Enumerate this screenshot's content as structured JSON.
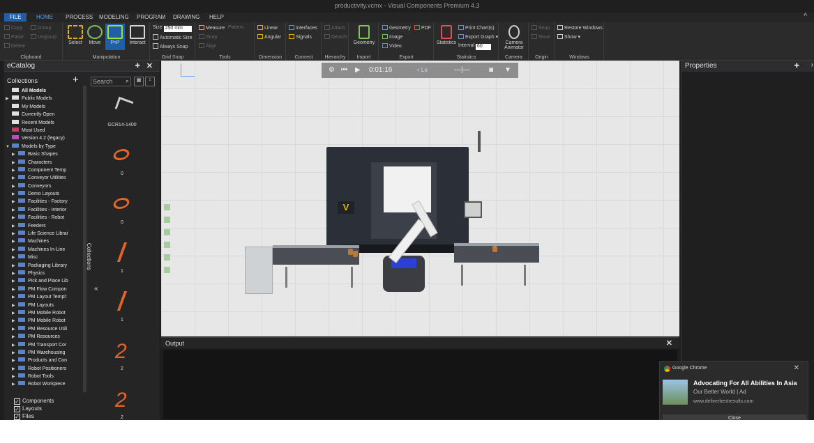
{
  "window": {
    "title": "productivity.vcmx - Visual Components Premium 4.3"
  },
  "menu": {
    "file": "FILE",
    "home": "HOME",
    "process": "PROCESS",
    "modeling": "MODELING",
    "program": "PROGRAM",
    "drawing": "DRAWING",
    "help": "HELP"
  },
  "ribbon": {
    "clipboard": {
      "copy": "Copy",
      "paste": "Paste",
      "delete": "Delete",
      "group": "Group",
      "ungroup": "Ungroup",
      "label": "Clipboard"
    },
    "manipulation": {
      "select": "Select",
      "move": "Move",
      "pnp": "PnP",
      "interact": "Interact",
      "label": "Manipulation"
    },
    "gridsnap": {
      "size_label": "Size",
      "size_value": "250",
      "unit": "mm",
      "automatic_size": "Automatic Size",
      "always_snap": "Always Snap",
      "label": "Grid Snap"
    },
    "tools": {
      "measure": "Measure",
      "pattern": "Pattern",
      "snap": "Snap",
      "align": "Align",
      "label": "Tools"
    },
    "dimension": {
      "linear": "Linear",
      "angular": "Angular",
      "label": "Dimension"
    },
    "connect": {
      "interfaces": "Interfaces",
      "signals": "Signals",
      "label": "Connect"
    },
    "hierarchy": {
      "attach": "Attach",
      "detach": "Detach",
      "label": "Hierarchy"
    },
    "import": {
      "geometry": "Geometry",
      "label": "Import"
    },
    "export": {
      "geometry": "Geometry",
      "pdf": "PDF",
      "image": "Image",
      "video": "Video",
      "label": "Export"
    },
    "statistics": {
      "statistics": "Statistics",
      "print_charts": "Print Chart(s)",
      "export_graph": "Export Graph",
      "interval": "Interval",
      "interval_value": "60",
      "label": "Statistics"
    },
    "camera": {
      "camera_animator": "Camera Animator",
      "label": "Camera"
    },
    "origin": {
      "snap": "Snap",
      "move": "Move",
      "label": "Origin"
    },
    "windows": {
      "restore": "Restore Windows",
      "show": "Show",
      "label": "Windows"
    }
  },
  "ecatalog": {
    "title": "eCatalog",
    "collections_title": "Collections",
    "search_placeholder": "Search",
    "collections_tab": "Collections",
    "tree": [
      {
        "label": "All Models",
        "icon": "w",
        "arrow": "",
        "bold": true
      },
      {
        "label": "Public Models",
        "icon": "w",
        "arrow": "▶"
      },
      {
        "label": "My Models",
        "icon": "w",
        "arrow": ""
      },
      {
        "label": "Currently Open",
        "icon": "w",
        "arrow": ""
      },
      {
        "label": "Recent Models",
        "icon": "w",
        "arrow": ""
      },
      {
        "label": "Most Used",
        "icon": "r",
        "arrow": ""
      },
      {
        "label": "Version 4.2 (legacy)",
        "icon": "p",
        "arrow": ""
      },
      {
        "label": "Models by Type",
        "icon": "b",
        "arrow": "▼"
      },
      {
        "label": "Basic Shapes",
        "icon": "b",
        "arrow": "▶",
        "indent": true
      },
      {
        "label": "Characters",
        "icon": "b",
        "arrow": "▶",
        "indent": true
      },
      {
        "label": "Component Temp",
        "icon": "b",
        "arrow": "▶",
        "indent": true
      },
      {
        "label": "Conveyor Utilities",
        "icon": "b",
        "arrow": "▶",
        "indent": true
      },
      {
        "label": "Conveyors",
        "icon": "b",
        "arrow": "▶",
        "indent": true
      },
      {
        "label": "Demo Layouts",
        "icon": "b",
        "arrow": "▶",
        "indent": true
      },
      {
        "label": "Facilities - Factory",
        "icon": "b",
        "arrow": "▶",
        "indent": true
      },
      {
        "label": "Facilities - Interior",
        "icon": "b",
        "arrow": "▶",
        "indent": true
      },
      {
        "label": "Facilities - Robot",
        "icon": "b",
        "arrow": "▶",
        "indent": true
      },
      {
        "label": "Feeders",
        "icon": "b",
        "arrow": "▶",
        "indent": true
      },
      {
        "label": "Life Science Librai",
        "icon": "b",
        "arrow": "▶",
        "indent": true
      },
      {
        "label": "Machines",
        "icon": "b",
        "arrow": "▶",
        "indent": true
      },
      {
        "label": "Machines In-Line",
        "icon": "b",
        "arrow": "▶",
        "indent": true
      },
      {
        "label": "Misc",
        "icon": "b",
        "arrow": "▶",
        "indent": true
      },
      {
        "label": "Packaging Library",
        "icon": "b",
        "arrow": "▶",
        "indent": true
      },
      {
        "label": "Physics",
        "icon": "b",
        "arrow": "▶",
        "indent": true
      },
      {
        "label": "Pick and Place Lib",
        "icon": "b",
        "arrow": "▶",
        "indent": true
      },
      {
        "label": "PM Flow Compon",
        "icon": "b",
        "arrow": "▶",
        "indent": true
      },
      {
        "label": "PM Layout Templ:",
        "icon": "b",
        "arrow": "▶",
        "indent": true
      },
      {
        "label": "PM Layouts",
        "icon": "b",
        "arrow": "▶",
        "indent": true
      },
      {
        "label": "PM Mobile Robot",
        "icon": "b",
        "arrow": "▶",
        "indent": true
      },
      {
        "label": "PM Mobile Robot",
        "icon": "b",
        "arrow": "▶",
        "indent": true
      },
      {
        "label": "PM Resource Utili",
        "icon": "b",
        "arrow": "▶",
        "indent": true
      },
      {
        "label": "PM Resources",
        "icon": "b",
        "arrow": "▶",
        "indent": true
      },
      {
        "label": "PM Transport Cor",
        "icon": "b",
        "arrow": "▶",
        "indent": true
      },
      {
        "label": "PM Warehousing",
        "icon": "b",
        "arrow": "▶",
        "indent": true
      },
      {
        "label": "Products and Con",
        "icon": "b",
        "arrow": "▶",
        "indent": true
      },
      {
        "label": "Robot Positioners",
        "icon": "b",
        "arrow": "▶",
        "indent": true
      },
      {
        "label": "Robot Tools",
        "icon": "b",
        "arrow": "▶",
        "indent": true
      },
      {
        "label": "Robot Workpiece",
        "icon": "b",
        "arrow": "▶",
        "indent": true
      }
    ],
    "bottom_checks": [
      "Components",
      "Layouts",
      "Files"
    ],
    "models": [
      {
        "name": "GCR14-1400",
        "shape": "robot"
      },
      {
        "name": "0",
        "shape": "o"
      },
      {
        "name": "0",
        "shape": "o"
      },
      {
        "name": "1",
        "shape": "one"
      },
      {
        "name": "1",
        "shape": "one"
      },
      {
        "name": "2",
        "shape": "two"
      },
      {
        "name": "2",
        "shape": "two"
      }
    ]
  },
  "viewport": {
    "time": "0:01:16",
    "speed": "+ Lo"
  },
  "output": {
    "title": "Output"
  },
  "properties": {
    "title": "Properties"
  },
  "notification": {
    "app": "Google Chrome",
    "title": "Advocating For All Abilities In Asia",
    "subtitle": "Our Better World | Ad",
    "url": "www.deliverbestresults.com",
    "button": "Close"
  }
}
